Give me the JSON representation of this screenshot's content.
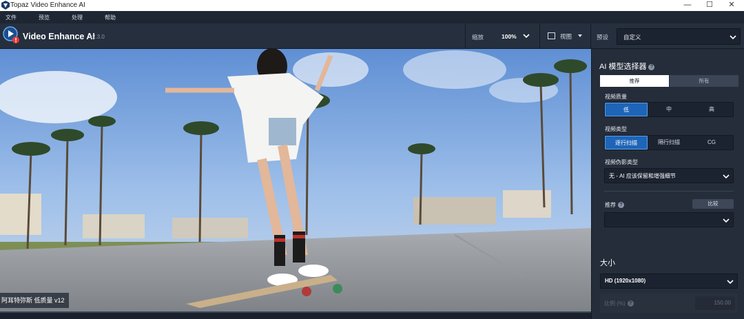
{
  "window": {
    "title": "Topaz Video Enhance AI",
    "minimize_glyph": "—",
    "maximize_glyph": "☐",
    "close_glyph": "✕"
  },
  "menu": [
    "文件",
    "预览",
    "处理",
    "帮助"
  ],
  "header": {
    "app_name": "Video Enhance AI",
    "version": "v2.3.0",
    "zoom_label": "缩放",
    "zoom_value": "100%",
    "view_label": "视图",
    "preset_label": "预设",
    "preset_value": "自定义"
  },
  "video": {
    "caption": "阿耳特弥斯 低质量 v12"
  },
  "panel": {
    "ai_model_title": "AI 模型选择器",
    "help_glyph": "?",
    "tabs": [
      {
        "label": "推荐",
        "active": true
      },
      {
        "label": "所有",
        "active": false
      }
    ],
    "quality": {
      "label": "视频质量",
      "options": [
        "低",
        "中",
        "高"
      ],
      "selected": 0
    },
    "type": {
      "label": "视频类型",
      "options": [
        "逐行扫描",
        "隔行扫描",
        "CG"
      ],
      "selected": 0
    },
    "artifacts": {
      "label": "视频伪影类型",
      "value": "无 - AI 应该保留和增强细节"
    },
    "recommend": {
      "label": "推荐",
      "compare_button": "比较",
      "value": ""
    },
    "size": {
      "title": "大小",
      "value": "HD (1920x1080)",
      "scale_label": "比例 (%)",
      "scale_value": "150.00"
    }
  },
  "colors": {
    "accent": "#1e65b8",
    "accent_border": "#5aa0ee",
    "panel_bg": "#252d3a",
    "header_bg": "#262f3d",
    "logo_badge": "#e53935"
  },
  "icons": [
    "topaz-app-icon",
    "video-enhance-logo",
    "chevron-down-icon",
    "view-icon",
    "help-icon"
  ]
}
